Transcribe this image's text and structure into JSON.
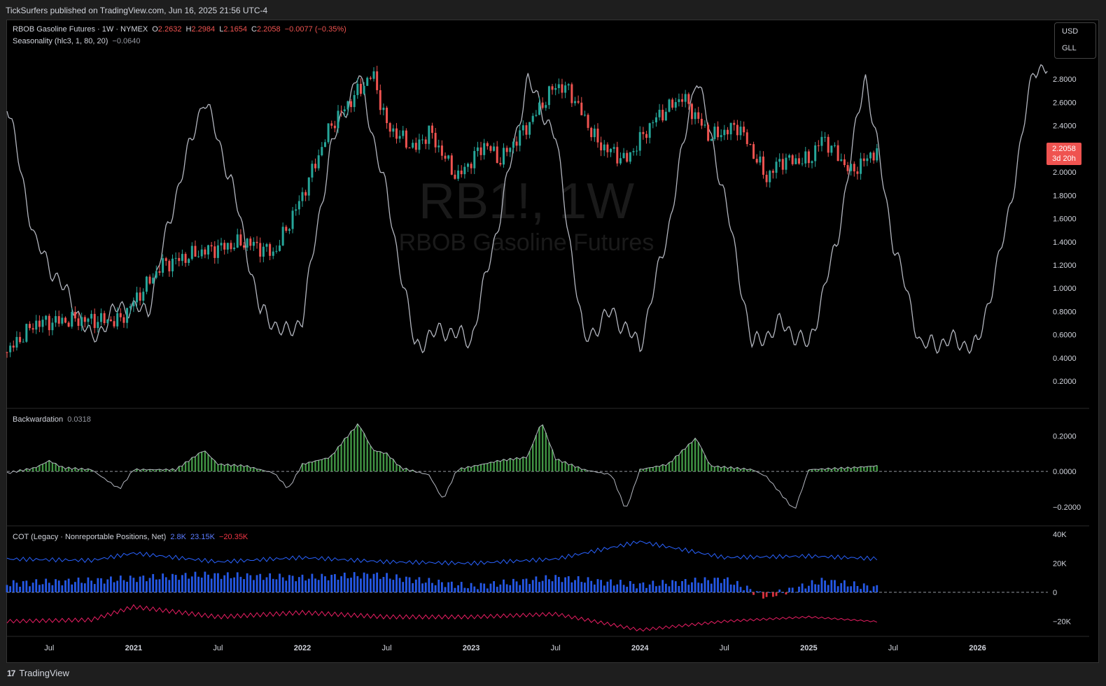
{
  "publisher_line": "TickSurfers published on TradingView.com, Jun 16, 2025 21:56 UTC-4",
  "footer": {
    "brand": "TradingView",
    "logo_mark": "17"
  },
  "currency": {
    "top": "USD",
    "bottom": "GLL"
  },
  "watermark": {
    "symbol": "RB1!, 1W",
    "name": "RBOB Gasoline Futures"
  },
  "legend_main": {
    "symbol": "RBOB Gasoline Futures · 1W · NYMEX",
    "o_label": "O",
    "o_value": "2.2632",
    "h_label": "H",
    "h_value": "2.2984",
    "l_label": "L",
    "l_value": "2.1654",
    "c_label": "C",
    "c_value": "2.2058",
    "change": "−0.0077 (−0.35%)"
  },
  "legend_season": {
    "name": "Seasonality (hlc3, 1, 80, 20)",
    "value": "−0.0640"
  },
  "legend_back": {
    "name": "Backwardation",
    "value": "0.0318"
  },
  "legend_cot": {
    "name": "COT (Legacy · Nonreportable Positions, Net)",
    "v1": "2.8K",
    "v2": "23.15K",
    "v3": "−20.35K"
  },
  "price_tag": {
    "price": "2.2058",
    "countdown": "3d 20h"
  },
  "colors": {
    "up": "#26a69a",
    "down": "#ef5350",
    "season": "#b2b5be",
    "backwardation": "#4caf50",
    "cot_long": "#2962ff",
    "cot_short": "#e91e63",
    "cot_hist_neg": "#f23645"
  },
  "chart_data": [
    {
      "type": "candlestick",
      "title": "RBOB Gasoline Futures · 1W · NYMEX",
      "time_axis": [
        "Jul",
        "2021",
        "Jul",
        "2022",
        "Jul",
        "2023",
        "Jul",
        "2024",
        "Jul",
        "2025",
        "Jul",
        "2026"
      ],
      "y_ticks": [
        "2.8000",
        "2.6000",
        "2.4000",
        "2.2000",
        "2.0000",
        "1.8000",
        "1.6000",
        "1.4000",
        "1.2000",
        "1.0000",
        "0.8000",
        "0.6000",
        "0.4000",
        "0.2000"
      ],
      "ylim": [
        0.05,
        3.0
      ],
      "close_path": [
        [
          "2020-04",
          0.45
        ],
        [
          "2020-06",
          0.7
        ],
        [
          "2020-09",
          0.73
        ],
        [
          "2020-12",
          0.72
        ],
        [
          "2021-03",
          1.2
        ],
        [
          "2021-06",
          1.32
        ],
        [
          "2021-09",
          1.4
        ],
        [
          "2021-11",
          1.3
        ],
        [
          "2022-01",
          1.8
        ],
        [
          "2022-03",
          2.4
        ],
        [
          "2022-06",
          2.85
        ],
        [
          "2022-07",
          2.4
        ],
        [
          "2022-09",
          2.2
        ],
        [
          "2022-10",
          2.35
        ],
        [
          "2022-12",
          1.95
        ],
        [
          "2023-02",
          2.25
        ],
        [
          "2023-03",
          2.1
        ],
        [
          "2023-05",
          2.4
        ],
        [
          "2023-07",
          2.75
        ],
        [
          "2023-08",
          2.7
        ],
        [
          "2023-10",
          2.25
        ],
        [
          "2023-12",
          2.1
        ],
        [
          "2024-02",
          2.45
        ],
        [
          "2024-04",
          2.65
        ],
        [
          "2024-06",
          2.3
        ],
        [
          "2024-08",
          2.4
        ],
        [
          "2024-10",
          1.95
        ],
        [
          "2024-11",
          2.1
        ],
        [
          "2025-01",
          2.1
        ],
        [
          "2025-02",
          2.3
        ],
        [
          "2025-04",
          2.0
        ],
        [
          "2025-06",
          2.2058
        ]
      ]
    },
    {
      "type": "line",
      "title": "Seasonality (hlc3, 1, 80, 20)",
      "points": [
        [
          "2020-04",
          2.6
        ],
        [
          "2020-06",
          1.4
        ],
        [
          "2020-09",
          0.8
        ],
        [
          "2020-10",
          0.55
        ],
        [
          "2020-12",
          0.85
        ],
        [
          "2021-02",
          0.8
        ],
        [
          "2021-04",
          1.8
        ],
        [
          "2021-06",
          2.65
        ],
        [
          "2021-08",
          1.9
        ],
        [
          "2021-10",
          0.8
        ],
        [
          "2021-12",
          0.6
        ],
        [
          "2022-01",
          0.75
        ],
        [
          "2022-03",
          2.2
        ],
        [
          "2022-05",
          2.85
        ],
        [
          "2022-07",
          1.8
        ],
        [
          "2022-09",
          0.5
        ],
        [
          "2022-11",
          0.65
        ],
        [
          "2023-01",
          0.55
        ],
        [
          "2023-03",
          1.6
        ],
        [
          "2023-05",
          2.8
        ],
        [
          "2023-07",
          2.3
        ],
        [
          "2023-09",
          0.55
        ],
        [
          "2023-11",
          0.8
        ],
        [
          "2024-01",
          0.5
        ],
        [
          "2024-03",
          1.5
        ],
        [
          "2024-05",
          2.85
        ],
        [
          "2024-07",
          1.8
        ],
        [
          "2024-09",
          0.5
        ],
        [
          "2024-11",
          0.7
        ],
        [
          "2025-01",
          0.5
        ],
        [
          "2025-03",
          1.4
        ],
        [
          "2025-05",
          2.85
        ],
        [
          "2025-07",
          1.4
        ],
        [
          "2025-09",
          0.5
        ],
        [
          "2025-11",
          0.55
        ],
        [
          "2026-01",
          0.5
        ],
        [
          "2026-03",
          1.5
        ],
        [
          "2026-05",
          2.9
        ]
      ]
    },
    {
      "type": "area",
      "title": "Backwardation",
      "y_ticks": [
        "0.2000",
        "0.0000",
        "−0.2000"
      ],
      "ylim": [
        -0.26,
        0.3
      ],
      "points": [
        [
          "2020-04",
          -0.01
        ],
        [
          "2020-06",
          0.02
        ],
        [
          "2020-07",
          0.06
        ],
        [
          "2020-08",
          0.02
        ],
        [
          "2020-10",
          0.01
        ],
        [
          "2020-12",
          -0.1
        ],
        [
          "2021-01",
          0.01
        ],
        [
          "2021-04",
          0.01
        ],
        [
          "2021-06",
          0.12
        ],
        [
          "2021-07",
          0.04
        ],
        [
          "2021-09",
          0.03
        ],
        [
          "2021-11",
          -0.01
        ],
        [
          "2021-12",
          -0.1
        ],
        [
          "2022-01",
          0.04
        ],
        [
          "2022-03",
          0.08
        ],
        [
          "2022-04",
          0.18
        ],
        [
          "2022-05",
          0.27
        ],
        [
          "2022-06",
          0.12
        ],
        [
          "2022-07",
          0.1
        ],
        [
          "2022-08",
          0.02
        ],
        [
          "2022-10",
          -0.02
        ],
        [
          "2022-11",
          -0.16
        ],
        [
          "2022-12",
          0.01
        ],
        [
          "2023-03",
          0.06
        ],
        [
          "2023-05",
          0.08
        ],
        [
          "2023-06",
          0.28
        ],
        [
          "2023-07",
          0.07
        ],
        [
          "2023-09",
          0.01
        ],
        [
          "2023-11",
          -0.02
        ],
        [
          "2023-12",
          -0.22
        ],
        [
          "2024-01",
          0.01
        ],
        [
          "2024-03",
          0.04
        ],
        [
          "2024-05",
          0.19
        ],
        [
          "2024-06",
          0.03
        ],
        [
          "2024-09",
          0.01
        ],
        [
          "2024-10",
          -0.03
        ],
        [
          "2024-12",
          -0.22
        ],
        [
          "2025-01",
          0.01
        ],
        [
          "2025-04",
          0.02
        ],
        [
          "2025-06",
          0.0318
        ]
      ]
    },
    {
      "type": "line",
      "title": "COT (Legacy · Nonreportable Positions, Net)",
      "y_ticks": [
        "40K",
        "20K",
        "0",
        "−20K"
      ],
      "ylim": [
        -28000,
        42000
      ],
      "series": [
        {
          "name": "",
          "values": [
            [
              "2020-04",
              23000
            ],
            [
              "2020-10",
              22000
            ],
            [
              "2021-01",
              27000
            ],
            [
              "2021-07",
              21000
            ],
            [
              "2022-01",
              24000
            ],
            [
              "2022-07",
              21000
            ],
            [
              "2023-01",
              20000
            ],
            [
              "2023-07",
              23000
            ],
            [
              "2024-01",
              35000
            ],
            [
              "2024-07",
              24000
            ],
            [
              "2025-01",
              25000
            ],
            [
              "2025-06",
              23150
            ]
          ]
        },
        {
          "name": "",
          "values": [
            [
              "2020-04",
              -20000
            ],
            [
              "2020-10",
              -19000
            ],
            [
              "2021-01",
              -10000
            ],
            [
              "2021-07",
              -17000
            ],
            [
              "2022-01",
              -14000
            ],
            [
              "2022-07",
              -17000
            ],
            [
              "2023-01",
              -17000
            ],
            [
              "2023-07",
              -15000
            ],
            [
              "2024-01",
              -26000
            ],
            [
              "2024-07",
              -20000
            ],
            [
              "2025-01",
              -17000
            ],
            [
              "2025-06",
              -20350
            ]
          ]
        },
        {
          "name": "",
          "values": [
            [
              "2020-04",
              6000
            ],
            [
              "2020-10",
              8000
            ],
            [
              "2021-06",
              12000
            ],
            [
              "2022-01",
              10000
            ],
            [
              "2022-06",
              12000
            ],
            [
              "2023-01",
              4000
            ],
            [
              "2023-07",
              10000
            ],
            [
              "2024-01",
              5000
            ],
            [
              "2024-07",
              9000
            ],
            [
              "2024-10",
              -3000
            ],
            [
              "2025-02",
              8000
            ],
            [
              "2025-06",
              2800
            ]
          ]
        }
      ]
    }
  ]
}
